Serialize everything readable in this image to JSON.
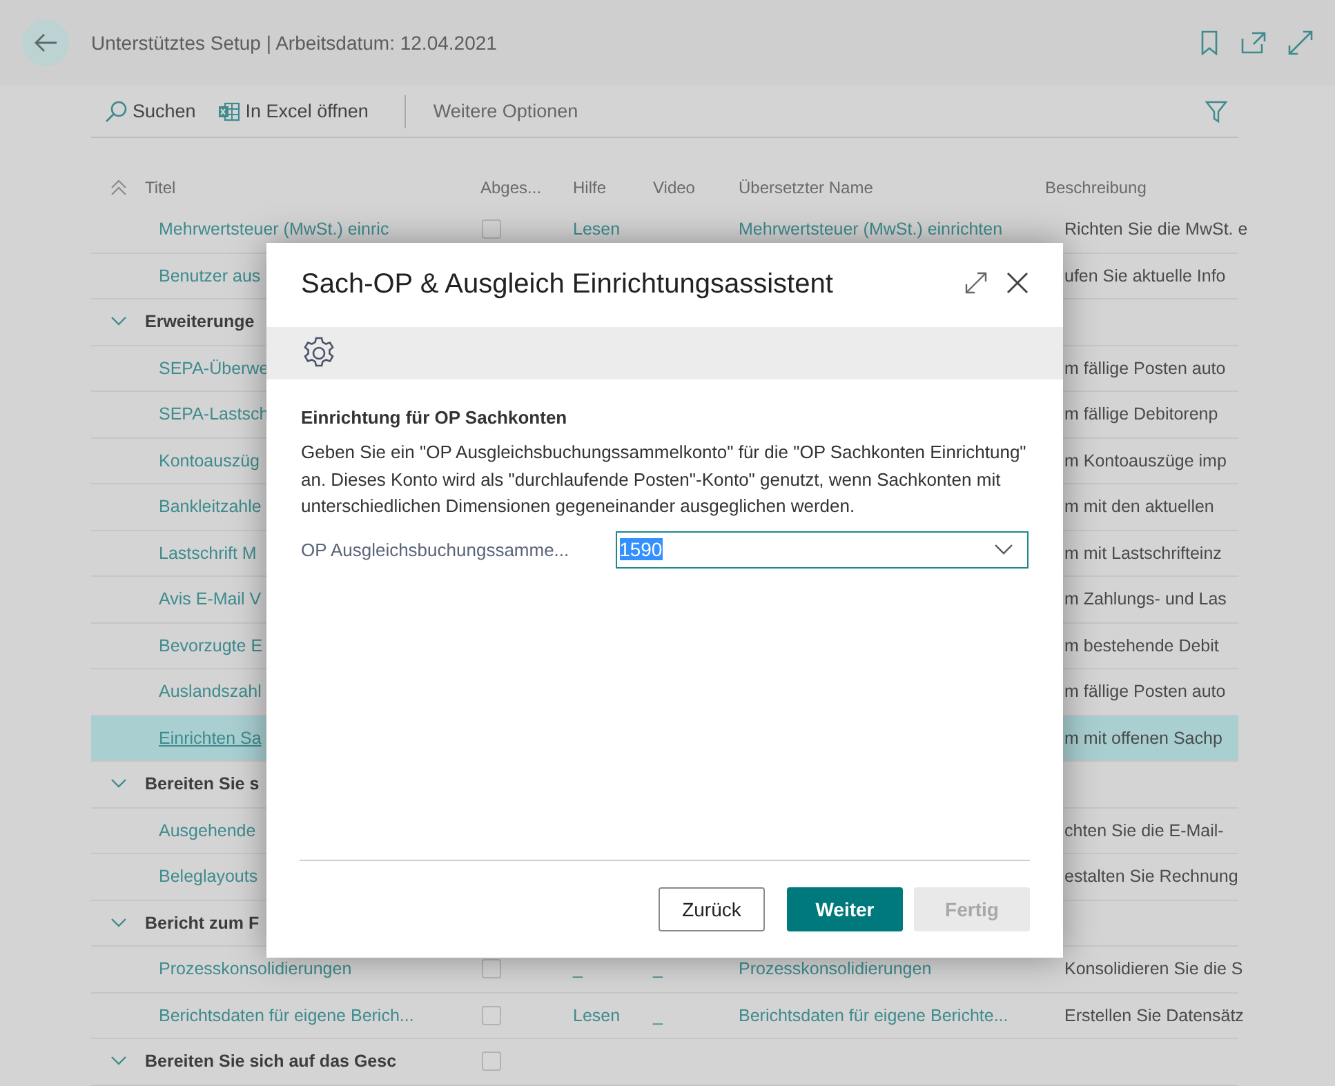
{
  "header": {
    "title": "Unterstütztes Setup | Arbeitsdatum: 12.04.2021"
  },
  "toolbar": {
    "actions": [
      {
        "kind": "search",
        "label": "Suchen"
      },
      {
        "kind": "excel",
        "label": "In Excel öffnen"
      }
    ],
    "more": "Weitere Optionen"
  },
  "table": {
    "columns": [
      "Titel",
      "Abges...",
      "Hilfe",
      "Video",
      "Übersetzter Name",
      "Beschreibung"
    ],
    "rows": [
      {
        "kind": "item",
        "title": "Mehrwertsteuer (MwSt.) einric",
        "selected": false,
        "done": false,
        "help": "Lesen",
        "translated": "Mehrwertsteuer (MwSt.) einrichten",
        "description": "Richten Sie die MwSt. e"
      },
      {
        "kind": "item",
        "title": "Benutzer aus",
        "selected": false,
        "description": "ufen Sie aktuelle Info"
      },
      {
        "kind": "group",
        "title": "Erweiterunge",
        "expanded": true
      },
      {
        "kind": "item",
        "title": "SEPA-Überwe",
        "selected": false,
        "description": "m fällige Posten auto"
      },
      {
        "kind": "item",
        "title": "SEPA-Lastsch",
        "selected": false,
        "description": "m fällige Debitorenp"
      },
      {
        "kind": "item",
        "title": "Kontoauszüg",
        "selected": false,
        "description": "m Kontoauszüge imp"
      },
      {
        "kind": "item",
        "title": "Bankleitzahle",
        "selected": false,
        "description": "m mit den aktuellen"
      },
      {
        "kind": "item",
        "title": "Lastschrift M",
        "selected": false,
        "description": "m mit Lastschrifteinz"
      },
      {
        "kind": "item",
        "title": "Avis E-Mail V",
        "selected": false,
        "description": "m Zahlungs- und Las"
      },
      {
        "kind": "item",
        "title": "Bevorzugte E",
        "selected": false,
        "description": "m bestehende Debit"
      },
      {
        "kind": "item",
        "title": "Auslandszahl",
        "selected": false,
        "description": "m fällige Posten auto"
      },
      {
        "kind": "item",
        "title": "Einrichten Sa",
        "selected": true,
        "description": "m mit offenen Sachp"
      },
      {
        "kind": "group",
        "title": "Bereiten Sie s",
        "expanded": true
      },
      {
        "kind": "item",
        "title": "Ausgehende",
        "selected": false,
        "description": "chten Sie die E-Mail-"
      },
      {
        "kind": "item",
        "title": "Beleglayouts",
        "selected": false,
        "description": "estalten Sie Rechnung"
      },
      {
        "kind": "group",
        "title": "Bericht zum F",
        "expanded": true
      },
      {
        "kind": "item",
        "title": "Prozesskonsolidierungen",
        "selected": false,
        "done": false,
        "help": "_",
        "video": "_",
        "translated": "Prozesskonsolidierungen",
        "description": "Konsolidieren Sie die S"
      },
      {
        "kind": "item",
        "title": "Berichtsdaten für eigene Berich...",
        "selected": false,
        "done": false,
        "help": "Lesen",
        "video": "_",
        "translated": "Berichtsdaten für eigene Berichte...",
        "description": "Erstellen Sie Datensätz"
      },
      {
        "kind": "group",
        "title": "Bereiten Sie sich auf das Gesc",
        "expanded": true,
        "done": false
      }
    ]
  },
  "dialog": {
    "title": "Sach-OP & Ausgleich Einrichtungsassistent",
    "heading": "Einrichtung für OP Sachkonten",
    "text": "Geben Sie ein \"OP Ausgleichsbuchungssammelkonto\" für die \"OP Sachkonten Einrichtung\" an. Dieses Konto wird als \"durchlaufende Posten\"-Konto\" genutzt, wenn Sachkonten mit unterschiedlichen Dimensionen gegeneinander ausgeglichen werden.",
    "field": {
      "label": "OP Ausgleichsbuchungssamme...",
      "value": "1590",
      "value_selected": true
    },
    "buttons": [
      {
        "kind": "default",
        "label": "Zurück",
        "disabled": false
      },
      {
        "kind": "primary",
        "label": "Weiter",
        "disabled": false
      },
      {
        "kind": "primary",
        "label": "Fertig",
        "disabled": true
      }
    ]
  }
}
